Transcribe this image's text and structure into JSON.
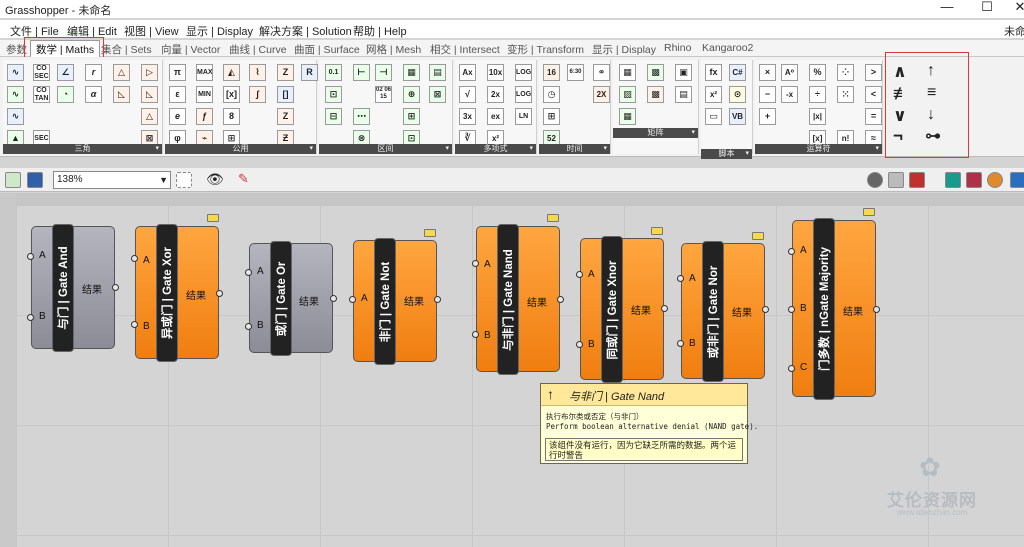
{
  "window": {
    "title": "Grasshopper - 未命名",
    "minimize": "—",
    "maximize": "☐",
    "close": "✕",
    "right_cut": "未命"
  },
  "menu": [
    "文件 | File",
    "编辑 | Edit",
    "视图 | View",
    "显示 | Display",
    "解决方案 | Solution",
    "帮助 | Help"
  ],
  "tabs": [
    {
      "label": "参数"
    },
    {
      "label": "数学 | Maths",
      "active": true
    },
    {
      "label": "集合 | Sets"
    },
    {
      "label": "向量 | Vector"
    },
    {
      "label": "曲线 | Curve"
    },
    {
      "label": "曲面 | Surface"
    },
    {
      "label": "网格 | Mesh"
    },
    {
      "label": "相交 | Intersect"
    },
    {
      "label": "变形 | Transform"
    },
    {
      "label": "显示 | Display"
    },
    {
      "label": "Rhino"
    },
    {
      "label": "Kangaroo2"
    }
  ],
  "ribbon": {
    "panels": [
      "三角",
      "公用",
      "区间",
      "多项式",
      "时间",
      "矩阵",
      "脚本",
      "运算符"
    ],
    "icons": {
      "trig": [
        "CO SEC",
        "r",
        "CO TAN",
        "α",
        "SEC"
      ],
      "util": [
        "π",
        "MAX",
        "ε",
        "MIN",
        "e",
        "8",
        "φ"
      ],
      "domain": [
        "0.1",
        "02 06 15"
      ],
      "poly": [
        "Ax",
        "10x",
        "LOG",
        "√",
        "2x",
        "LOGn",
        "3x",
        "ex",
        "LN",
        "∛",
        "x²",
        "x³"
      ],
      "time": [
        "16",
        "6:30",
        "2X",
        "52"
      ],
      "script": [
        "fx",
        "x²",
        "C#",
        "VB"
      ],
      "ops": [
        "×",
        "A⁰",
        "%",
        "−",
        "-x",
        "÷",
        "+",
        "|x|",
        "=",
        "[x]",
        "n!",
        "≈",
        ">",
        "<"
      ],
      "gates": [
        "∧",
        "↑",
        "≢",
        "≡",
        "∨",
        "↓",
        "¬",
        "⊶"
      ]
    }
  },
  "toolbar": {
    "zoom": "138%",
    "zoom_arrow": "▼"
  },
  "components": [
    {
      "name": "与门 | Gate And",
      "inputs": [
        "A",
        "B"
      ],
      "output": "结果",
      "style": "grey"
    },
    {
      "name": "异或门 | Gate Xor",
      "inputs": [
        "A",
        "B"
      ],
      "output": "结果",
      "style": "orange"
    },
    {
      "name": "或门 | Gate Or",
      "inputs": [
        "A",
        "B"
      ],
      "output": "结果",
      "style": "grey"
    },
    {
      "name": "非门 | Gate Not",
      "inputs": [
        "A"
      ],
      "output": "结果",
      "style": "orange"
    },
    {
      "name": "与非门 | Gate Nand",
      "inputs": [
        "A",
        "B"
      ],
      "output": "结果",
      "style": "orange"
    },
    {
      "name": "同或门 | Gate Xnor",
      "inputs": [
        "A",
        "B"
      ],
      "output": "结果",
      "style": "orange"
    },
    {
      "name": "或非门 | Gate Nor",
      "inputs": [
        "A",
        "B"
      ],
      "output": "结果",
      "style": "orange"
    },
    {
      "name": "门多数 | nGate Majority",
      "inputs": [
        "A",
        "B",
        "C"
      ],
      "output": "结果",
      "style": "orange"
    }
  ],
  "tooltip": {
    "icon": "↑",
    "title": "与非门 | Gate Nand",
    "desc_cn": "执行布尔类或否定（与非门）",
    "desc_en": "Perform boolean alternative denial (NAND gate).",
    "warning": "该组件没有运行，因为它缺乏所需的数据。两个运行时警告"
  },
  "watermark": {
    "icon": "✿",
    "text": "艾伦资源网",
    "url": "www.allenzhan.com"
  },
  "colors": {
    "accent_red": "#e0373a",
    "gate_orange": "#f08a18",
    "gate_grey": "#9d9da8",
    "tooltip_bg": "#ffffd8"
  }
}
